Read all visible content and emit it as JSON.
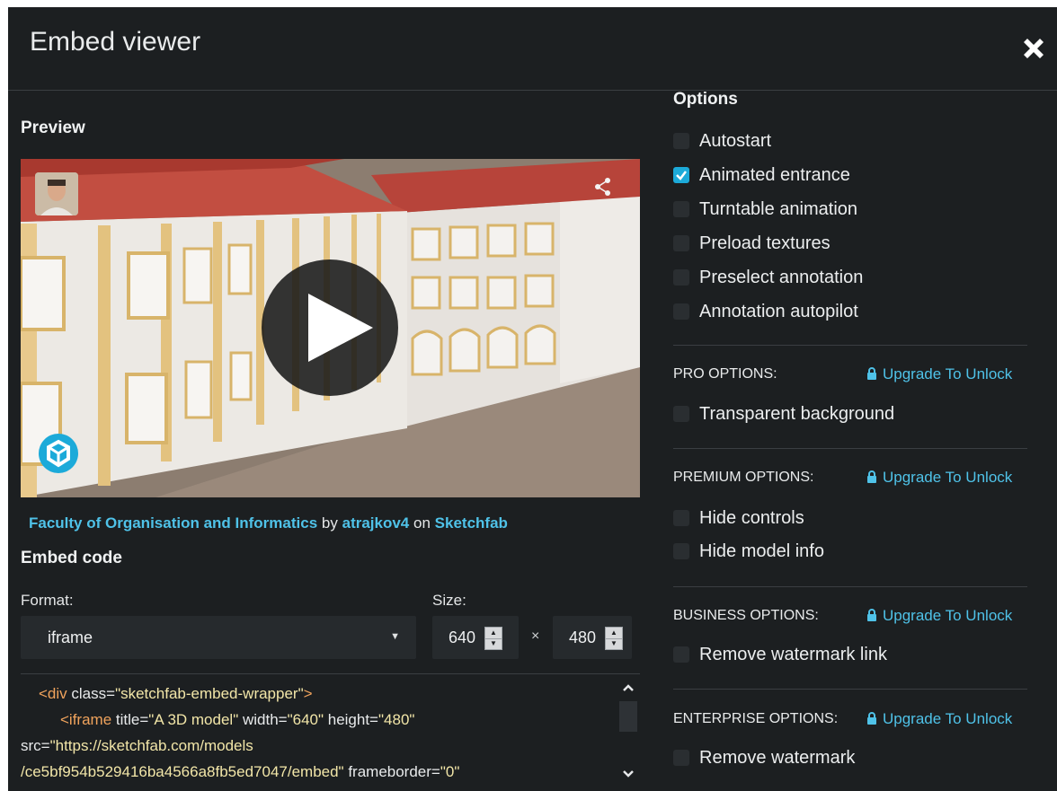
{
  "modal": {
    "title": "Embed viewer"
  },
  "preview": {
    "title": "Preview",
    "model_link": "Faculty of Organisation and Informatics",
    "by_text": "by",
    "author_link": "atrajkov4",
    "on_text": "on",
    "site_link": "Sketchfab"
  },
  "embed": {
    "title": "Embed code",
    "format_label": "Format:",
    "format_value": "iframe",
    "size_label": "Size:",
    "width": "640",
    "height": "480",
    "times": "×",
    "code": {
      "line1_tag": "<div",
      "line1_attr": " class=",
      "line1_val": "\"sketchfab-embed-wrapper\"",
      "line1_end": ">",
      "line2_tag": "<iframe",
      "line2_a1": " title=",
      "line2_v1": "\"A 3D model\"",
      "line2_a2": " width=",
      "line2_v2": "\"640\"",
      "line2_a3": " height=",
      "line2_v3": "\"480\"",
      "line3_a": "src=",
      "line3_v": "\"https://sketchfab.com/models",
      "line4_v": "/ce5bf954b529416ba4566a8fb5ed7047/embed\"",
      "line4_a": " frameborder=",
      "line4_v2": "\"0\""
    }
  },
  "options": {
    "title": "Options",
    "basic": [
      {
        "label": "Autostart",
        "checked": false
      },
      {
        "label": "Animated entrance",
        "checked": true
      },
      {
        "label": "Turntable animation",
        "checked": false
      },
      {
        "label": "Preload textures",
        "checked": false
      },
      {
        "label": "Preselect annotation",
        "checked": false
      },
      {
        "label": "Annotation autopilot",
        "checked": false
      }
    ],
    "upgrade_label": "Upgrade To Unlock",
    "pro": {
      "label": "PRO OPTIONS:",
      "items": [
        "Transparent background"
      ]
    },
    "premium": {
      "label": "PREMIUM OPTIONS:",
      "items": [
        "Hide controls",
        "Hide model info"
      ]
    },
    "business": {
      "label": "BUSINESS OPTIONS:",
      "items": [
        "Remove watermark link"
      ]
    },
    "enterprise": {
      "label": "ENTERPRISE OPTIONS:",
      "items": [
        "Remove watermark"
      ]
    }
  },
  "colors": {
    "background": "#1c1f21",
    "accent": "#1caad9",
    "link": "#4fc2e8"
  },
  "icons": [
    "close-icon",
    "share-icon",
    "play-icon",
    "sketchfab-logo-icon",
    "lock-icon",
    "check-icon",
    "chevron-down-icon",
    "chevron-up-icon"
  ]
}
